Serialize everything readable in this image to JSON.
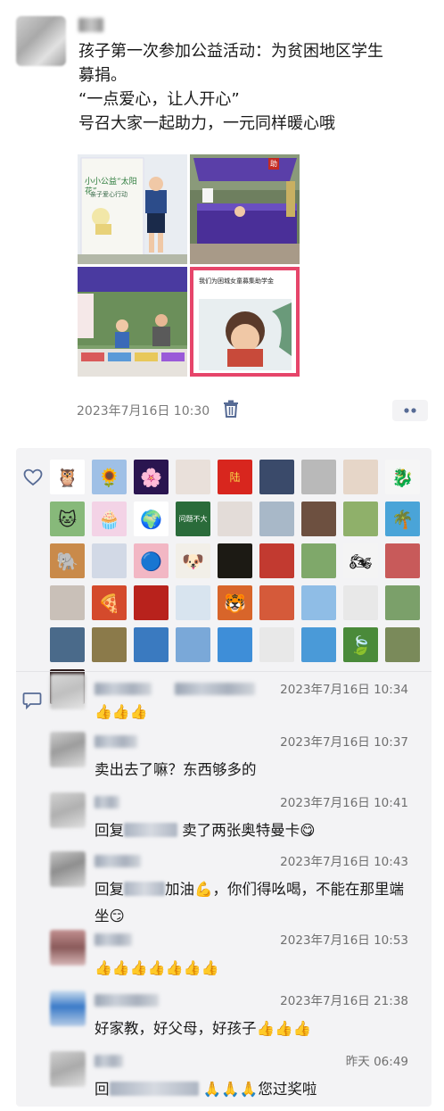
{
  "post": {
    "lines": [
      "孩子第一次参加公益活动：为贫困地区学生",
      "募捐。",
      "“一点爱心，让人开心”",
      "号召大家一起助力，一元同样暖心哦"
    ],
    "photo1_title": "小小公益“太阳花”",
    "photo1_subtitle": "亲子爱心行动",
    "photo4_caption": "我们为困城女童募集助学金",
    "photo2_flag": "助",
    "time": "2023年7月16日 10:30"
  },
  "likers": {
    "tiles": [
      {
        "name": "owl-avatar",
        "bg": "#ffffff",
        "glyph": "🦉"
      },
      {
        "name": "sunflower-avatar",
        "bg": "#9fc0e6",
        "glyph": "🌻"
      },
      {
        "name": "neon-flower-avatar",
        "bg": "#2a1550",
        "glyph": "🌸"
      },
      {
        "name": "woman-portrait-avatar",
        "bg": "#e9e0da",
        "glyph": ""
      },
      {
        "name": "red-badge-avatar",
        "bg": "#d8261e",
        "glyph": "陆"
      },
      {
        "name": "city-night-avatar",
        "bg": "#3a4a6a",
        "glyph": ""
      },
      {
        "name": "street-photo-avatar",
        "bg": "#b9b9b9",
        "glyph": ""
      },
      {
        "name": "man-glasses-avatar",
        "bg": "#e6d6c8",
        "glyph": ""
      },
      {
        "name": "dragon-avatar",
        "bg": "#f6f6f6",
        "glyph": "🐉"
      },
      {
        "name": "white-cat-avatar",
        "bg": "#87b97a",
        "glyph": "🐱"
      },
      {
        "name": "pink-cake-avatar",
        "bg": "#f3d3e6",
        "glyph": "🧁"
      },
      {
        "name": "globes-avatar",
        "bg": "#ffffff",
        "glyph": "🌍"
      },
      {
        "name": "green-text-avatar",
        "bg": "#2a6b3a",
        "glyph": "问题不大"
      },
      {
        "name": "bride-avatar",
        "bg": "#e3dcd8",
        "glyph": ""
      },
      {
        "name": "rock-statue-avatar",
        "bg": "#a8b8c8",
        "glyph": ""
      },
      {
        "name": "man-portrait-avatar",
        "bg": "#6d5040",
        "glyph": ""
      },
      {
        "name": "meadow-avatar",
        "bg": "#8fb06a",
        "glyph": ""
      },
      {
        "name": "palm-tree-avatar",
        "bg": "#4aa4d8",
        "glyph": "🌴"
      },
      {
        "name": "mammoth-avatar",
        "bg": "#c98a4a",
        "glyph": "🐘"
      },
      {
        "name": "woman-scarf-avatar",
        "bg": "#d2d9e6",
        "glyph": ""
      },
      {
        "name": "doraemon-avatar",
        "bg": "#f2b7c4",
        "glyph": "🔵"
      },
      {
        "name": "puppies-avatar",
        "bg": "#f2efe8",
        "glyph": "🐶"
      },
      {
        "name": "sunset-trees-avatar",
        "bg": "#1c1a14",
        "glyph": ""
      },
      {
        "name": "opera-avatar",
        "bg": "#c23a30",
        "glyph": ""
      },
      {
        "name": "field-path-avatar",
        "bg": "#7fa86a",
        "glyph": ""
      },
      {
        "name": "motorbike-avatar",
        "bg": "#f4f4f4",
        "glyph": "🏍"
      },
      {
        "name": "woman-red-avatar",
        "bg": "#c85a5a",
        "glyph": ""
      },
      {
        "name": "boy-photo-avatar",
        "bg": "#c9c0b8",
        "glyph": ""
      },
      {
        "name": "pizza-avatar",
        "bg": "#d44a2c",
        "glyph": "🍕"
      },
      {
        "name": "couple-red-avatar",
        "bg": "#b8221c",
        "glyph": ""
      },
      {
        "name": "snow-mountain-avatar",
        "bg": "#d8e4ef",
        "glyph": ""
      },
      {
        "name": "tiger-avatar",
        "bg": "#d8652a",
        "glyph": "🐯"
      },
      {
        "name": "couple-silhouette-avatar",
        "bg": "#d55a3a",
        "glyph": ""
      },
      {
        "name": "blue-man-avatar",
        "bg": "#8fbde6",
        "glyph": ""
      },
      {
        "name": "man-sitting-avatar",
        "bg": "#e8e8e8",
        "glyph": ""
      },
      {
        "name": "hills-avatar",
        "bg": "#7ba06a",
        "glyph": ""
      },
      {
        "name": "horizon-road-avatar",
        "bg": "#4a6a8a",
        "glyph": ""
      },
      {
        "name": "railway-avatar",
        "bg": "#8b7a4a",
        "glyph": ""
      },
      {
        "name": "sea-avatar",
        "bg": "#3a7ac0",
        "glyph": ""
      },
      {
        "name": "sky-mountain-avatar",
        "bg": "#7aa8d8",
        "glyph": ""
      },
      {
        "name": "sky-cloud-avatar",
        "bg": "#3e8ed8",
        "glyph": ""
      },
      {
        "name": "dancer-avatar",
        "bg": "#e8e8e8",
        "glyph": ""
      },
      {
        "name": "bird-man-avatar",
        "bg": "#4a9ad8",
        "glyph": ""
      },
      {
        "name": "leaves-avatar",
        "bg": "#4a8a3a",
        "glyph": "🍃"
      },
      {
        "name": "valley-avatar",
        "bg": "#7a8a5a",
        "glyph": ""
      },
      {
        "name": "concert-avatar",
        "bg": "#2a1a1a",
        "glyph": ""
      }
    ]
  },
  "comments": [
    {
      "time": "2023年7月16日 10:34",
      "parts": [
        "👍👍👍"
      ]
    },
    {
      "time": "2023年7月16日 10:37",
      "parts": [
        "卖出去了嘛？东西够多的"
      ]
    },
    {
      "time": "2023年7月16日 10:41",
      "parts": [
        "回复",
        "卖了两张奥特曼卡😋"
      ]
    },
    {
      "time": "2023年7月16日 10:43",
      "parts": [
        "回复",
        "加油💪，你们得吆喝，不能在那里端坐😏"
      ]
    },
    {
      "time": "2023年7月16日 10:53",
      "parts": [
        "👍👍👍👍👍👍👍"
      ]
    },
    {
      "time": "2023年7月16日 21:38",
      "parts": [
        "好家教，好父母，好孩子👍👍👍"
      ]
    },
    {
      "time": "昨天 06:49",
      "parts": [
        "回",
        "🙏🙏🙏您过奖啦"
      ]
    }
  ],
  "colors": {
    "accent": "#576b95",
    "panel": "#f3f3f5"
  }
}
